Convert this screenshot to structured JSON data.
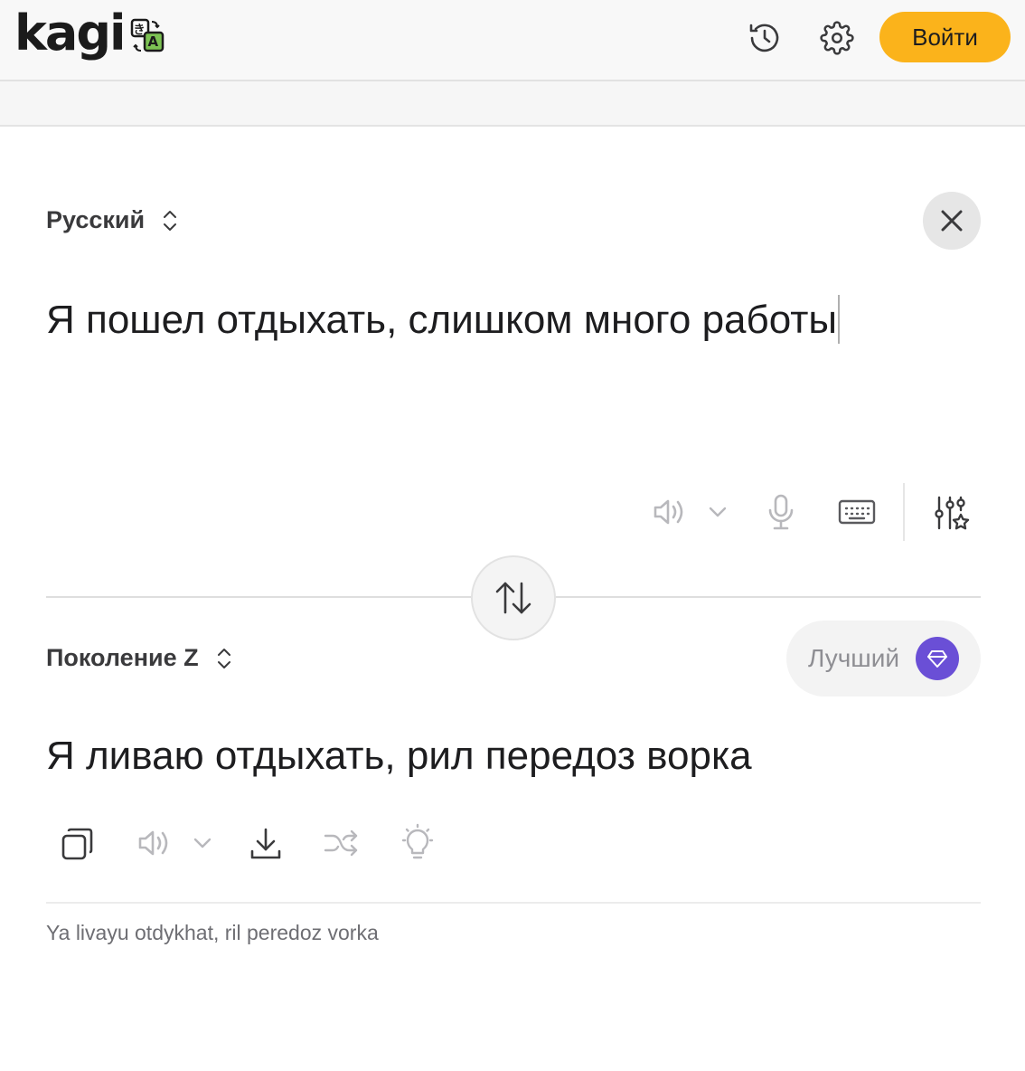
{
  "app": {
    "logo_text": "kagi",
    "badge_glyph": "き",
    "badge_letter": "A"
  },
  "header": {
    "history_icon": "history-icon",
    "settings_icon": "gear-icon",
    "login_label": "Войти"
  },
  "source": {
    "language": "Русский",
    "text": "Я пошел отдыхать, слишком много работы",
    "tools": [
      "speaker-icon",
      "chevron-down-icon",
      "microphone-icon",
      "keyboard-icon",
      "sliders-star-icon"
    ]
  },
  "target": {
    "language": "Поколение Z",
    "quality_label": "Лучший",
    "text": "Я ливаю отдыхать, рил передоз ворка",
    "transliteration": "Ya livayu otdykhat, ril peredoz vorka",
    "tools": [
      "copy-icon",
      "speaker-icon",
      "chevron-down-icon",
      "download-icon",
      "shuffle-icon",
      "lightbulb-icon"
    ]
  },
  "colors": {
    "accent": "#fbb31b",
    "quality_gem": "#6a4fd6",
    "badge_green": "#7cc253"
  }
}
